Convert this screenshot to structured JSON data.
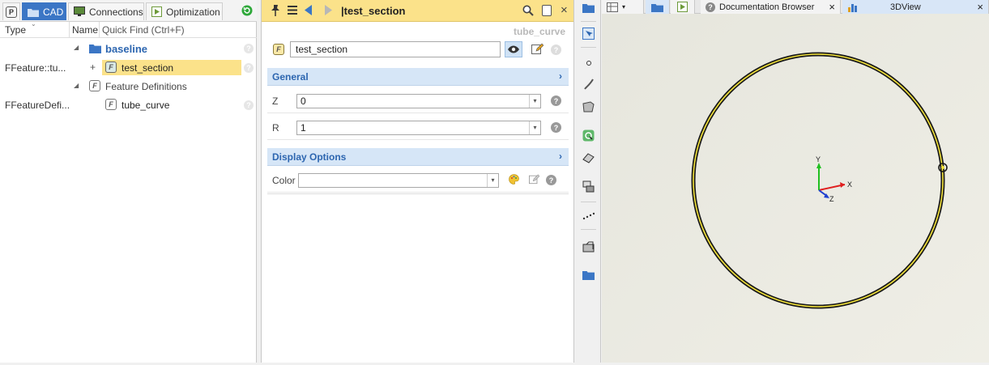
{
  "left_panel": {
    "tabs": [
      {
        "label": "P"
      },
      {
        "label": "CAD"
      },
      {
        "label": "Connections"
      },
      {
        "label": "Optimization"
      }
    ],
    "columns": {
      "type": "Type",
      "name": "Name",
      "quick_find": "Quick Find (Ctrl+F)"
    },
    "tree": [
      {
        "type": "",
        "label": "baseline",
        "toggle": "◢"
      },
      {
        "type": "FFeature::tu...",
        "label": "test_section",
        "toggle": "+",
        "badge": "F"
      },
      {
        "type": "",
        "label": "Feature Definitions",
        "toggle": "◢",
        "badge": "F"
      },
      {
        "type": "FFeatureDefi...",
        "label": "tube_curve",
        "badge": "F"
      }
    ]
  },
  "middle_panel": {
    "title": "|test_section",
    "subtitle": "tube_curve",
    "name_value": "test_section",
    "badge": "F",
    "sections": {
      "general": {
        "title": "General",
        "properties": [
          {
            "label": "Z",
            "value": "0"
          },
          {
            "label": "R",
            "value": "1"
          }
        ]
      },
      "display": {
        "title": "Display Options",
        "properties": [
          {
            "label": "Color",
            "value": ""
          }
        ]
      }
    }
  },
  "right_panel": {
    "tabs": [
      {
        "label": "Documentation Browser",
        "close": "×"
      },
      {
        "label": "3DView",
        "close": "×"
      }
    ],
    "axes": {
      "x": "X",
      "y": "Y",
      "z": "Z"
    },
    "colors": {
      "circle_outer": "#1a1a1a",
      "circle_inner": "#f2e23a",
      "viewport_bg": "#ecebe2",
      "accent": "#3b76c5",
      "title_bar": "#fbe28a"
    }
  }
}
